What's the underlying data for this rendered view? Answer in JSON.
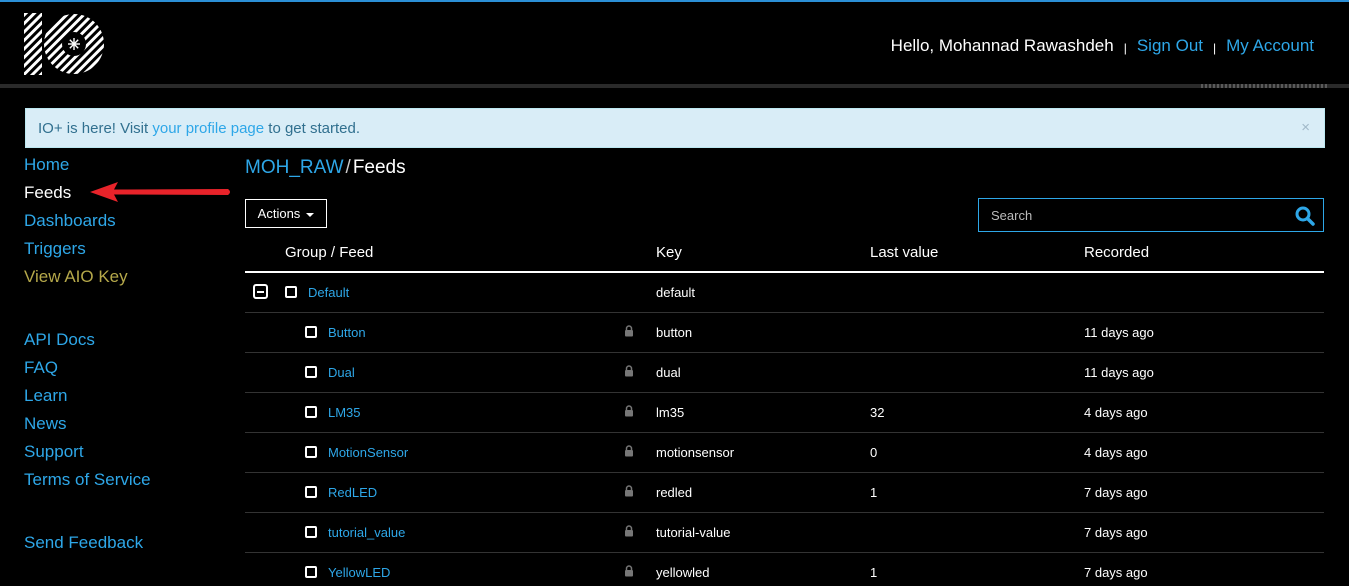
{
  "header": {
    "logo_icon": "io-logo-icon",
    "greeting": "Hello, Mohannad Rawashdeh",
    "separator": "|",
    "sign_out": "Sign Out",
    "my_account": "My Account"
  },
  "alert": {
    "prefix": "IO+ is here! Visit ",
    "link": "your profile page",
    "suffix": " to get started.",
    "close": "×"
  },
  "sidebar": {
    "items": [
      {
        "label": "Home"
      },
      {
        "label": "Feeds"
      },
      {
        "label": "Dashboards"
      },
      {
        "label": "Triggers"
      },
      {
        "label": "View AIO Key"
      },
      {
        "label": "API Docs"
      },
      {
        "label": "FAQ"
      },
      {
        "label": "Learn"
      },
      {
        "label": "News"
      },
      {
        "label": "Support"
      },
      {
        "label": "Terms of Service"
      },
      {
        "label": "Send Feedback"
      }
    ]
  },
  "annotation": {
    "arrow_color": "#e8232a"
  },
  "breadcrumb": {
    "user": "MOH_RAW",
    "separator": "/",
    "current": "Feeds"
  },
  "toolbar": {
    "actions_label": "Actions"
  },
  "search": {
    "placeholder": "Search"
  },
  "table": {
    "columns": {
      "group_feed": "Group / Feed",
      "key": "Key",
      "last_value": "Last value",
      "recorded": "Recorded"
    },
    "group": {
      "name": "Default",
      "key": "default"
    },
    "rows": [
      {
        "name": "Button",
        "key": "button",
        "last_value": "",
        "recorded": "11 days ago"
      },
      {
        "name": "Dual",
        "key": "dual",
        "last_value": "",
        "recorded": "11 days ago"
      },
      {
        "name": "LM35",
        "key": "lm35",
        "last_value": "32",
        "recorded": "4 days ago"
      },
      {
        "name": "MotionSensor",
        "key": "motionsensor",
        "last_value": "0",
        "recorded": "4 days ago"
      },
      {
        "name": "RedLED",
        "key": "redled",
        "last_value": "1",
        "recorded": "7 days ago"
      },
      {
        "name": "tutorial_value",
        "key": "tutorial-value",
        "last_value": "",
        "recorded": "7 days ago"
      },
      {
        "name": "YellowLED",
        "key": "yellowled",
        "last_value": "1",
        "recorded": "7 days ago"
      }
    ]
  },
  "colors": {
    "accent": "#2ea7e8",
    "alert_bg": "#d9edf7",
    "key_link": "#b5a84a",
    "background": "#000000"
  }
}
